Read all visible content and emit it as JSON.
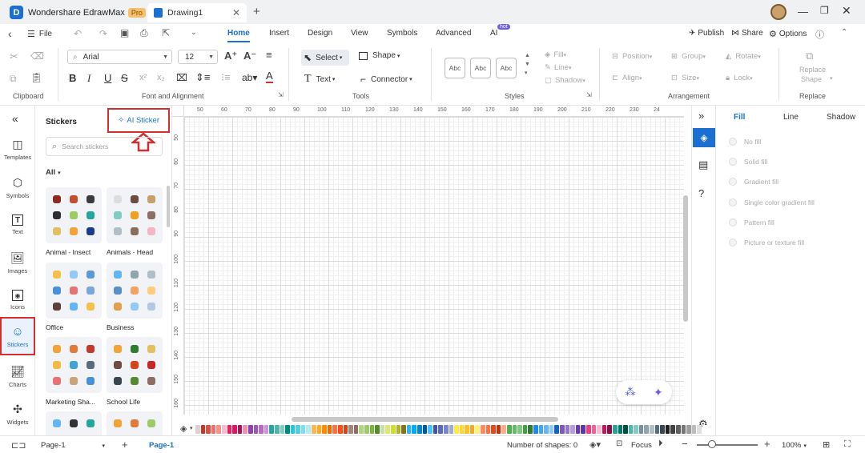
{
  "titlebar": {
    "app_name": "Wondershare EdrawMax",
    "pro_badge": "Pro",
    "doc_tab": "Drawing1"
  },
  "menubar": {
    "file": "File",
    "tabs": [
      "Home",
      "Insert",
      "Design",
      "View",
      "Symbols",
      "Advanced",
      "AI"
    ],
    "ai_badge": "hot",
    "publish": "Publish",
    "share": "Share",
    "options": "Options"
  },
  "ribbon": {
    "font_name": "Arial",
    "font_size": "12",
    "select": "Select",
    "shape": "Shape",
    "text": "Text",
    "connector": "Connector",
    "style_samples": [
      "Abc",
      "Abc",
      "Abc"
    ],
    "fill": "Fill",
    "line": "Line",
    "shadow": "Shadow",
    "position": "Position",
    "group": "Group",
    "rotate": "Rotate",
    "align": "Align",
    "size": "Size",
    "lock": "Lock",
    "replace_shape_1": "Replace",
    "replace_shape_2": "Shape",
    "groups": {
      "clipboard": "Clipboard",
      "font": "Font and Alignment",
      "tools": "Tools",
      "styles": "Styles",
      "arrangement": "Arrangement",
      "replace": "Replace"
    }
  },
  "leftbar": {
    "items": [
      "Templates",
      "Symbols",
      "Text",
      "Images",
      "Icons",
      "Stickers",
      "Charts",
      "Widgets"
    ]
  },
  "stickers": {
    "title": "Stickers",
    "ai_button": "AI Sticker",
    "search_placeholder": "Search stickers",
    "filter": "All",
    "categories": [
      "Animal - Insect",
      "Animals - Head",
      "Office",
      "Business",
      "Marketing Sha...",
      "School Life"
    ]
  },
  "ruler": {
    "top": [
      "50",
      "60",
      "70",
      "80",
      "90",
      "100",
      "110",
      "120",
      "130",
      "140",
      "150",
      "160",
      "170",
      "180",
      "190",
      "200",
      "210",
      "220",
      "230",
      "24"
    ],
    "left": [
      "50",
      "60",
      "70",
      "80",
      "90",
      "100",
      "110",
      "120",
      "130",
      "140",
      "150",
      "160"
    ]
  },
  "props": {
    "tabs": [
      "Fill",
      "Line",
      "Shadow"
    ],
    "fill_options": [
      "No fill",
      "Solid fill",
      "Gradient fill",
      "Single color gradient fill",
      "Pattern fill",
      "Picture or texture fill"
    ]
  },
  "status": {
    "page_selector": "Page-1",
    "page_tab": "Page-1",
    "shapes": "Number of shapes: 0",
    "focus": "Focus",
    "zoom": "100%"
  },
  "colors": {
    "accent": "#1a6fd1",
    "highlight": "#d32f2f",
    "palette": [
      "#e0d0d0",
      "#c0392b",
      "#e74c3c",
      "#e57373",
      "#f1948a",
      "#f8bbd0",
      "#e91e63",
      "#d81b60",
      "#ad1457",
      "#f48fb1",
      "#8e44ad",
      "#9b59b6",
      "#ba68c8",
      "#ce93d8",
      "#26a69a",
      "#4db6ac",
      "#80cbc4",
      "#00897b",
      "#26c6da",
      "#4dd0e1",
      "#80deea",
      "#b2ebf2",
      "#ffb74d",
      "#ffa726",
      "#fb8c00",
      "#ef6c00",
      "#ff7043",
      "#f4511e",
      "#d84315",
      "#a1887f",
      "#8d6e63",
      "#aed581",
      "#9ccc65",
      "#7cb342",
      "#558b2f",
      "#c5e1a5",
      "#dce775",
      "#cddc39",
      "#afb42b",
      "#827717",
      "#29b6f6",
      "#03a9f4",
      "#0288d1",
      "#01579b",
      "#4fc3f7",
      "#3f51b5",
      "#5c6bc0",
      "#7986cb",
      "#9fa8da",
      "#ffeb3b",
      "#fdd835",
      "#fbc02d",
      "#f9a825",
      "#fff176",
      "#ff8a65",
      "#ff7043",
      "#e64a19",
      "#bf360c",
      "#ffab91",
      "#4caf50",
      "#66bb6a",
      "#81c784",
      "#43a047",
      "#2e7d32",
      "#1e88e5",
      "#42a5f5",
      "#64b5f6",
      "#90caf9",
      "#1565c0",
      "#7e57c2",
      "#9575cd",
      "#b39ddb",
      "#673ab7",
      "#5e35b1",
      "#ec407a",
      "#f06292",
      "#f8bbd0",
      "#c2185b",
      "#880e4f",
      "#26a69a",
      "#00796b",
      "#004d40",
      "#4db6ac",
      "#80cbc4",
      "#78909c",
      "#90a4ae",
      "#b0bec5",
      "#546e7a",
      "#37474f",
      "#212121",
      "#424242",
      "#616161",
      "#757575",
      "#9e9e9e",
      "#bdbdbd",
      "#e0e0e0",
      "#ffffff"
    ]
  }
}
